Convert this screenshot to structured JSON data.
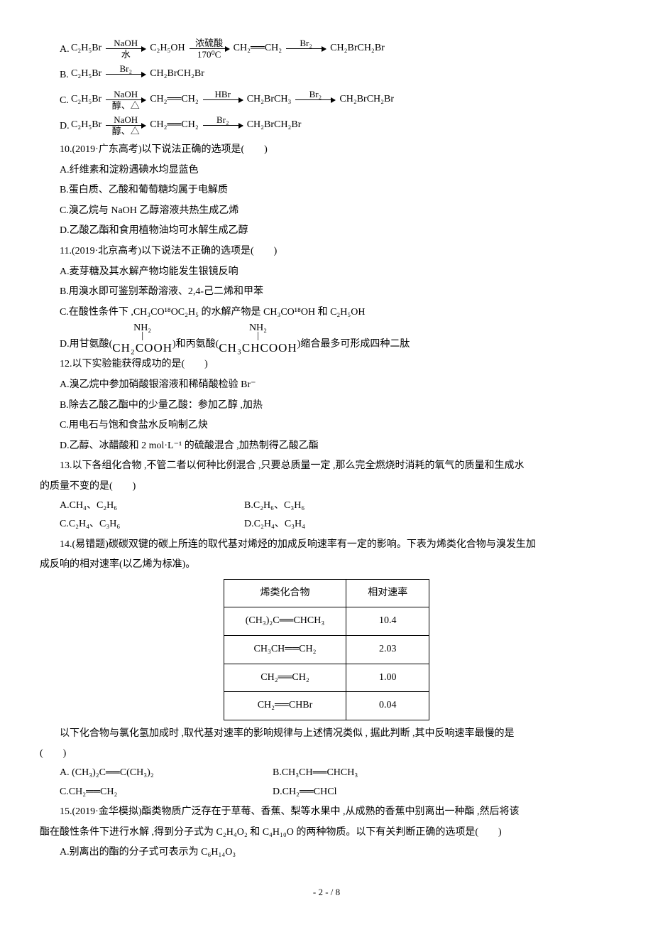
{
  "q9": {
    "A": {
      "label": "A.",
      "s1": "C₂H₅Br",
      "a1t": "NaOH",
      "a1b": "水",
      "s2": "C₂H₅OH",
      "a2t": "浓硫酸",
      "a2b": "170⁰C",
      "s3": "CH₂══CH₂",
      "a3t": "Br₂",
      "s4": "CH₂BrCH₂Br"
    },
    "B": {
      "label": "B.",
      "s1": "C₂H₅Br",
      "a1t": "Br₂",
      "s2": "CH₂BrCH₂Br"
    },
    "C": {
      "label": "C.",
      "s1": "C₂H₅Br",
      "a1t": "NaOH",
      "a1b": "醇、△",
      "s2": "CH₂══CH₂",
      "a2t": "HBr",
      "s3": "CH₂BrCH₃",
      "a3t": "Br₂",
      "s4": "CH₂BrCH₂Br"
    },
    "D": {
      "label": "D.",
      "s1": "C₂H₅Br",
      "a1t": "NaOH",
      "a1b": "醇、△",
      "s2": "CH₂══CH₂",
      "a2t": "Br₂",
      "s3": "CH₂BrCH₂Br"
    }
  },
  "q10": {
    "stem": "10.(2019·广东高考)以下说法正确的选项是(　　)",
    "A": "A.纤维素和淀粉遇碘水均显蓝色",
    "B": "B.蛋白质、乙酸和葡萄糖均属于电解质",
    "C": "C.溴乙烷与 NaOH 乙醇溶液共热生成乙烯",
    "D": "D.乙酸乙酯和食用植物油均可水解生成乙醇"
  },
  "q11": {
    "stem": "11.(2019·北京高考)以下说法不正确的选项是(　　)",
    "A": "A.麦芽糖及其水解产物均能发生银镜反响",
    "B": "B.用溴水即可鉴别苯酚溶液、2,4-己二烯和甲苯",
    "C": "C.在酸性条件下 ,CH₃CO¹⁸OC₂H₅ 的水解产物是 CH₃CO¹⁸OH 和 C₂H₅OH",
    "D_pre": "D.用甘氨酸(",
    "D_nh1": "NH₂",
    "D_f1": "CH₂COOH",
    "D_mid": ")和丙氨酸(",
    "D_nh2": "NH₂",
    "D_f2": "CH₃CHCOOH",
    "D_post": ")缩合最多可形成四种二肽"
  },
  "q12": {
    "stem": "12.以下实验能获得成功的是(　　)",
    "A": "A.溴乙烷中参加硝酸银溶液和稀硝酸检验 Br⁻",
    "B": "B.除去乙酸乙酯中的少量乙酸：参加乙醇 ,加热",
    "C": "C.用电石与饱和食盐水反响制乙炔",
    "D": "D.乙醇、冰醋酸和 2 mol·L⁻¹ 的硫酸混合 ,加热制得乙酸乙酯"
  },
  "q13": {
    "stem": "13.以下各组化合物 ,不管二者以何种比例混合 ,只要总质量一定 ,那么完全燃烧时消耗的氧气的质量和生成水",
    "stem2": "的质量不变的是(　　)",
    "A": "A.CH₄、C₂H₆",
    "B": "B.C₂H₆、C₃H₆",
    "C": "C.C₂H₄、C₃H₆",
    "D": "D.C₂H₄、C₃H₄"
  },
  "q14": {
    "stem": "14.(易错题)碳碳双键的碳上所连的取代基对烯烃的加成反响速率有一定的影响。下表为烯类化合物与溴发生加",
    "stem2": "成反响的相对速率(以乙烯为标准)。",
    "th1": "烯类化合物",
    "th2": "相对速率",
    "r1c1": "(CH₃)₂C══CHCH₃",
    "r1c2": "10.4",
    "r2c1": "CH₃CH══CH₂",
    "r2c2": "2.03",
    "r3c1": "CH₂══CH₂",
    "r3c2": "1.00",
    "r4c1": "CH₂══CHBr",
    "r4c2": "0.04",
    "after": "以下化合物与氯化氢加成时 ,取代基对速率的影响规律与上述情况类似 , 据此判断 ,其中反响速率最慢的是",
    "after2": "(　　)",
    "A": "A. (CH₃)₂C══C(CH₃)₂",
    "B": "B.CH₃CH══CHCH₃",
    "C": "C.CH₂══CH₂",
    "D": "D.CH₂══CHCl"
  },
  "q15": {
    "stem": "15.(2019·金华模拟)酯类物质广泛存在于草莓、香蕉、梨等水果中 ,从成熟的香蕉中别离出一种酯 ,然后将该",
    "stem2": "酯在酸性条件下进行水解 ,得到分子式为 C₂H₄O₂ 和 C₄H₁₀O 的两种物质。以下有关判断正确的选项是(　　)",
    "A": "A.别离出的酯的分子式可表示为 C₆H₁₄O₃"
  },
  "footer": "- 2 -  / 8",
  "chart_data": {
    "type": "table",
    "columns": [
      "烯类化合物",
      "相对速率"
    ],
    "rows": [
      [
        "(CH₃)₂C══CHCH₃",
        10.4
      ],
      [
        "CH₃CH══CH₂",
        2.03
      ],
      [
        "CH₂══CH₂",
        1.0
      ],
      [
        "CH₂══CHBr",
        0.04
      ]
    ]
  }
}
